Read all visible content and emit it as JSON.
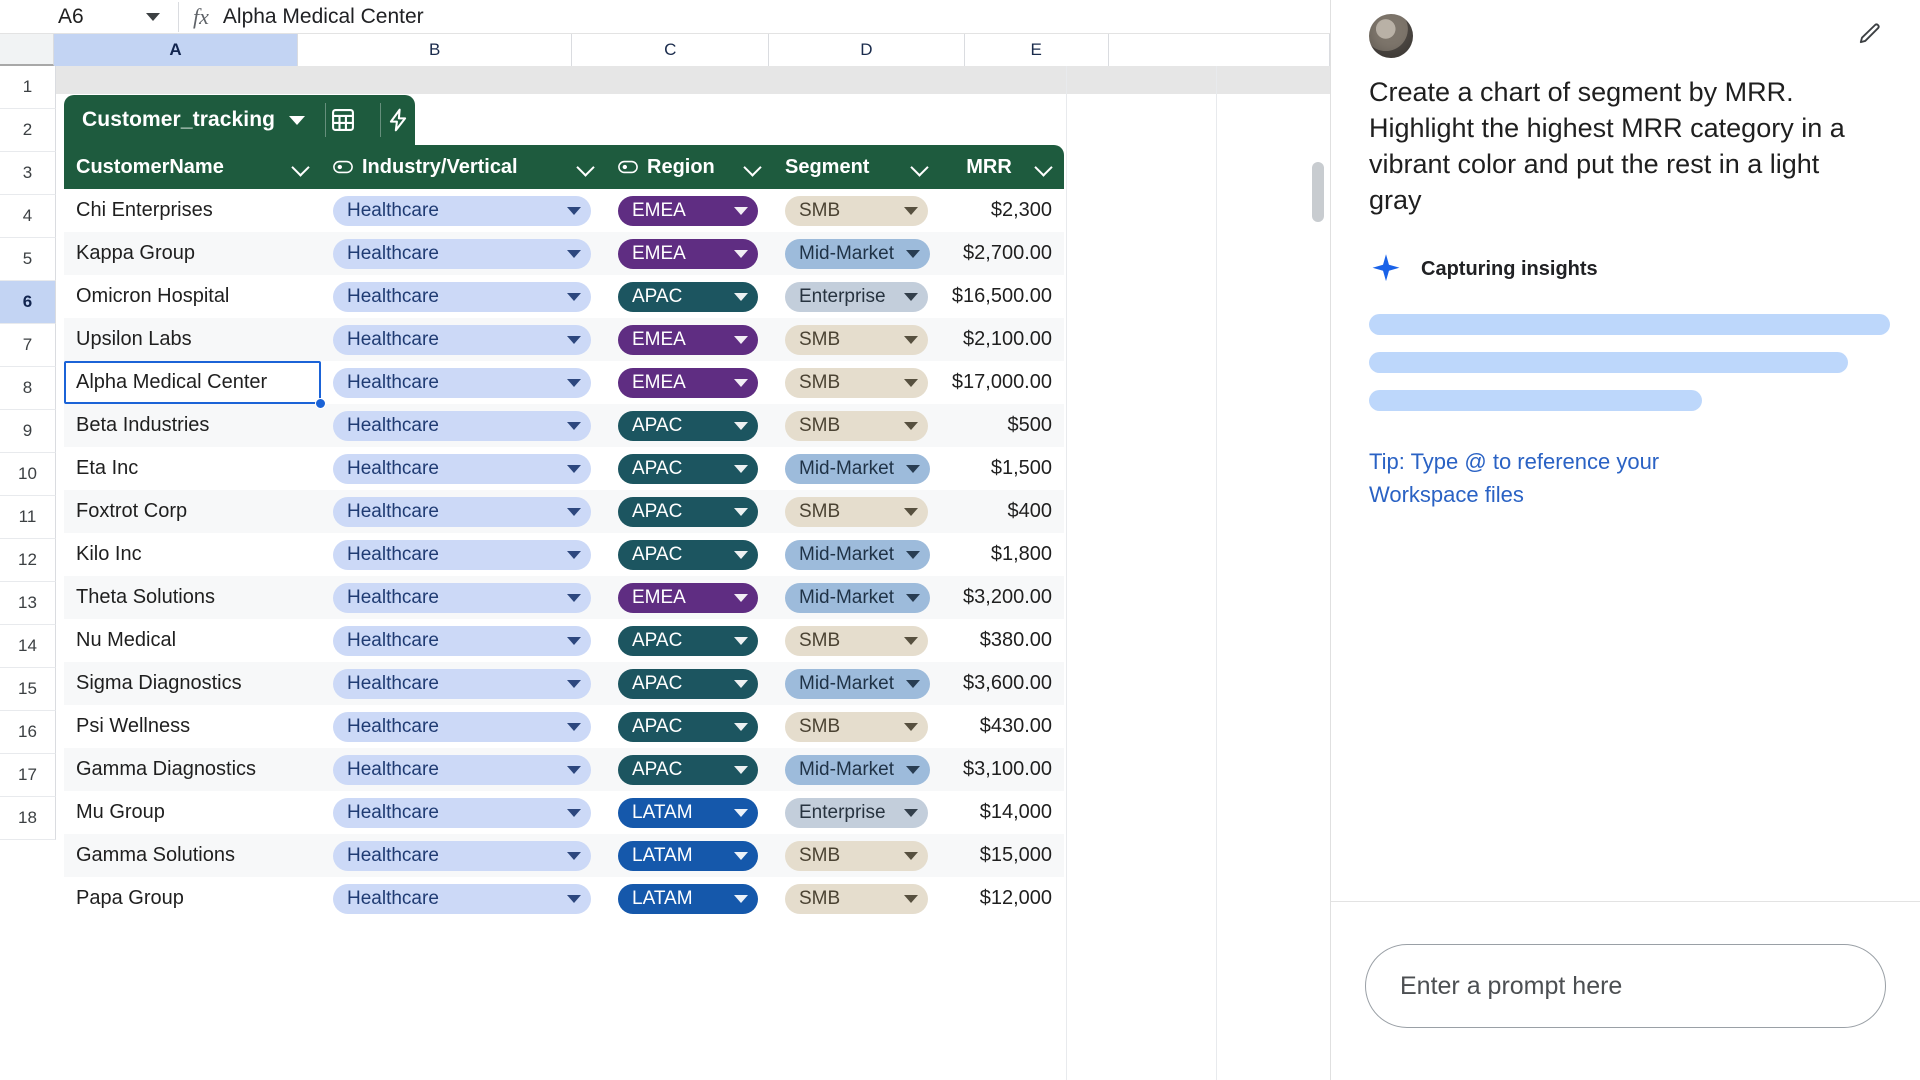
{
  "formula_bar": {
    "name_box": "A6",
    "fx_icon": "fx-icon",
    "value": "Alpha Medical Center"
  },
  "grid": {
    "column_letters": [
      "A",
      "B",
      "C",
      "D",
      "E"
    ],
    "selected_column": "A",
    "row_numbers": [
      "1",
      "2",
      "3",
      "4",
      "5",
      "6",
      "7",
      "8",
      "9",
      "10",
      "11",
      "12",
      "13",
      "14",
      "15",
      "16",
      "17",
      "18"
    ],
    "selected_row": "6"
  },
  "table": {
    "name": "Customer_tracking",
    "tab_caret_icon": "chevron-down-icon",
    "tools": [
      {
        "icon": "table-calc-icon"
      },
      {
        "icon": "lightning-bolt-icon"
      }
    ],
    "columns": [
      {
        "label": "CustomerName",
        "has_filter_icon": false,
        "caret_icon": "chevron-down-icon"
      },
      {
        "label": "Industry/Vertical",
        "has_filter_icon": true,
        "caret_icon": "chevron-down-icon"
      },
      {
        "label": "Region",
        "has_filter_icon": true,
        "caret_icon": "chevron-down-icon"
      },
      {
        "label": "Segment",
        "has_filter_icon": false,
        "caret_icon": "chevron-down-icon"
      },
      {
        "label": "MRR",
        "has_filter_icon": false,
        "caret_icon": "chevron-down-icon"
      }
    ],
    "rows": [
      {
        "row": "2",
        "name": "Chi Enterprises",
        "industry": "Healthcare",
        "region": "EMEA",
        "segment": "SMB",
        "mrr": "$2,300"
      },
      {
        "row": "3",
        "name": "Kappa Group",
        "industry": "Healthcare",
        "region": "EMEA",
        "segment": "Mid-Market",
        "mrr": "$2,700.00"
      },
      {
        "row": "4",
        "name": "Omicron Hospital",
        "industry": "Healthcare",
        "region": "APAC",
        "segment": "Enterprise",
        "mrr": "$16,500.00"
      },
      {
        "row": "5",
        "name": "Upsilon Labs",
        "industry": "Healthcare",
        "region": "EMEA",
        "segment": "SMB",
        "mrr": "$2,100.00"
      },
      {
        "row": "6",
        "name": "Alpha Medical Center",
        "industry": "Healthcare",
        "region": "EMEA",
        "segment": "SMB",
        "mrr": "$17,000.00"
      },
      {
        "row": "7",
        "name": "Beta Industries",
        "industry": "Healthcare",
        "region": "APAC",
        "segment": "SMB",
        "mrr": "$500"
      },
      {
        "row": "8",
        "name": "Eta Inc",
        "industry": "Healthcare",
        "region": "APAC",
        "segment": "Mid-Market",
        "mrr": "$1,500"
      },
      {
        "row": "9",
        "name": "Foxtrot Corp",
        "industry": "Healthcare",
        "region": "APAC",
        "segment": "SMB",
        "mrr": "$400"
      },
      {
        "row": "10",
        "name": "Kilo Inc",
        "industry": "Healthcare",
        "region": "APAC",
        "segment": "Mid-Market",
        "mrr": "$1,800"
      },
      {
        "row": "11",
        "name": "Theta Solutions",
        "industry": "Healthcare",
        "region": "EMEA",
        "segment": "Mid-Market",
        "mrr": "$3,200.00"
      },
      {
        "row": "12",
        "name": "Nu Medical",
        "industry": "Healthcare",
        "region": "APAC",
        "segment": "SMB",
        "mrr": "$380.00"
      },
      {
        "row": "13",
        "name": "Sigma Diagnostics",
        "industry": "Healthcare",
        "region": "APAC",
        "segment": "Mid-Market",
        "mrr": "$3,600.00"
      },
      {
        "row": "14",
        "name": "Psi Wellness",
        "industry": "Healthcare",
        "region": "APAC",
        "segment": "SMB",
        "mrr": "$430.00"
      },
      {
        "row": "15",
        "name": "Gamma Diagnostics",
        "industry": "Healthcare",
        "region": "APAC",
        "segment": "Mid-Market",
        "mrr": "$3,100.00"
      },
      {
        "row": "16",
        "name": "Mu Group",
        "industry": "Healthcare",
        "region": "LATAM",
        "segment": "Enterprise",
        "mrr": "$14,000"
      },
      {
        "row": "17",
        "name": "Gamma Solutions",
        "industry": "Healthcare",
        "region": "LATAM",
        "segment": "SMB",
        "mrr": "$15,000"
      },
      {
        "row": "18",
        "name": "Papa Group",
        "industry": "Healthcare",
        "region": "LATAM",
        "segment": "SMB",
        "mrr": "$12,000"
      }
    ]
  },
  "colors": {
    "table_green": "#1e5b3e",
    "industry_chip_bg": "#ccd9f7",
    "industry_chip_fg": "#1f3b73",
    "region_emea_bg": "#5f2d82",
    "region_apac_bg": "#1c5560",
    "region_latam_bg": "#1558ab",
    "region_fg": "#ffffff",
    "segment_smb_bg": "#e5ddcd",
    "segment_smb_fg": "#4b4333",
    "segment_mid_bg": "#9dbbdb",
    "segment_mid_fg": "#1f3246",
    "segment_ent_bg": "#c3cedb",
    "segment_ent_fg": "#27333f",
    "selection_blue": "#1b63d7",
    "header_select_blue": "#c3d4f3",
    "ai_link_blue": "#2a62c4",
    "skeleton_blue": "#bdd7fb",
    "spark_blue": "#1a62e8"
  },
  "ai_panel": {
    "avatar_icon": "user-avatar",
    "edit_icon": "pencil-edit-icon",
    "user_prompt": "Create a chart of segment by MRR. Highlight the highest MRR category in a vibrant color and put the rest in a light gray",
    "status_icon": "sparkle-icon",
    "status_text": "Capturing insights",
    "tip_text": "Tip: Type @ to reference your Workspace files",
    "composer_placeholder": "Enter a prompt here"
  }
}
